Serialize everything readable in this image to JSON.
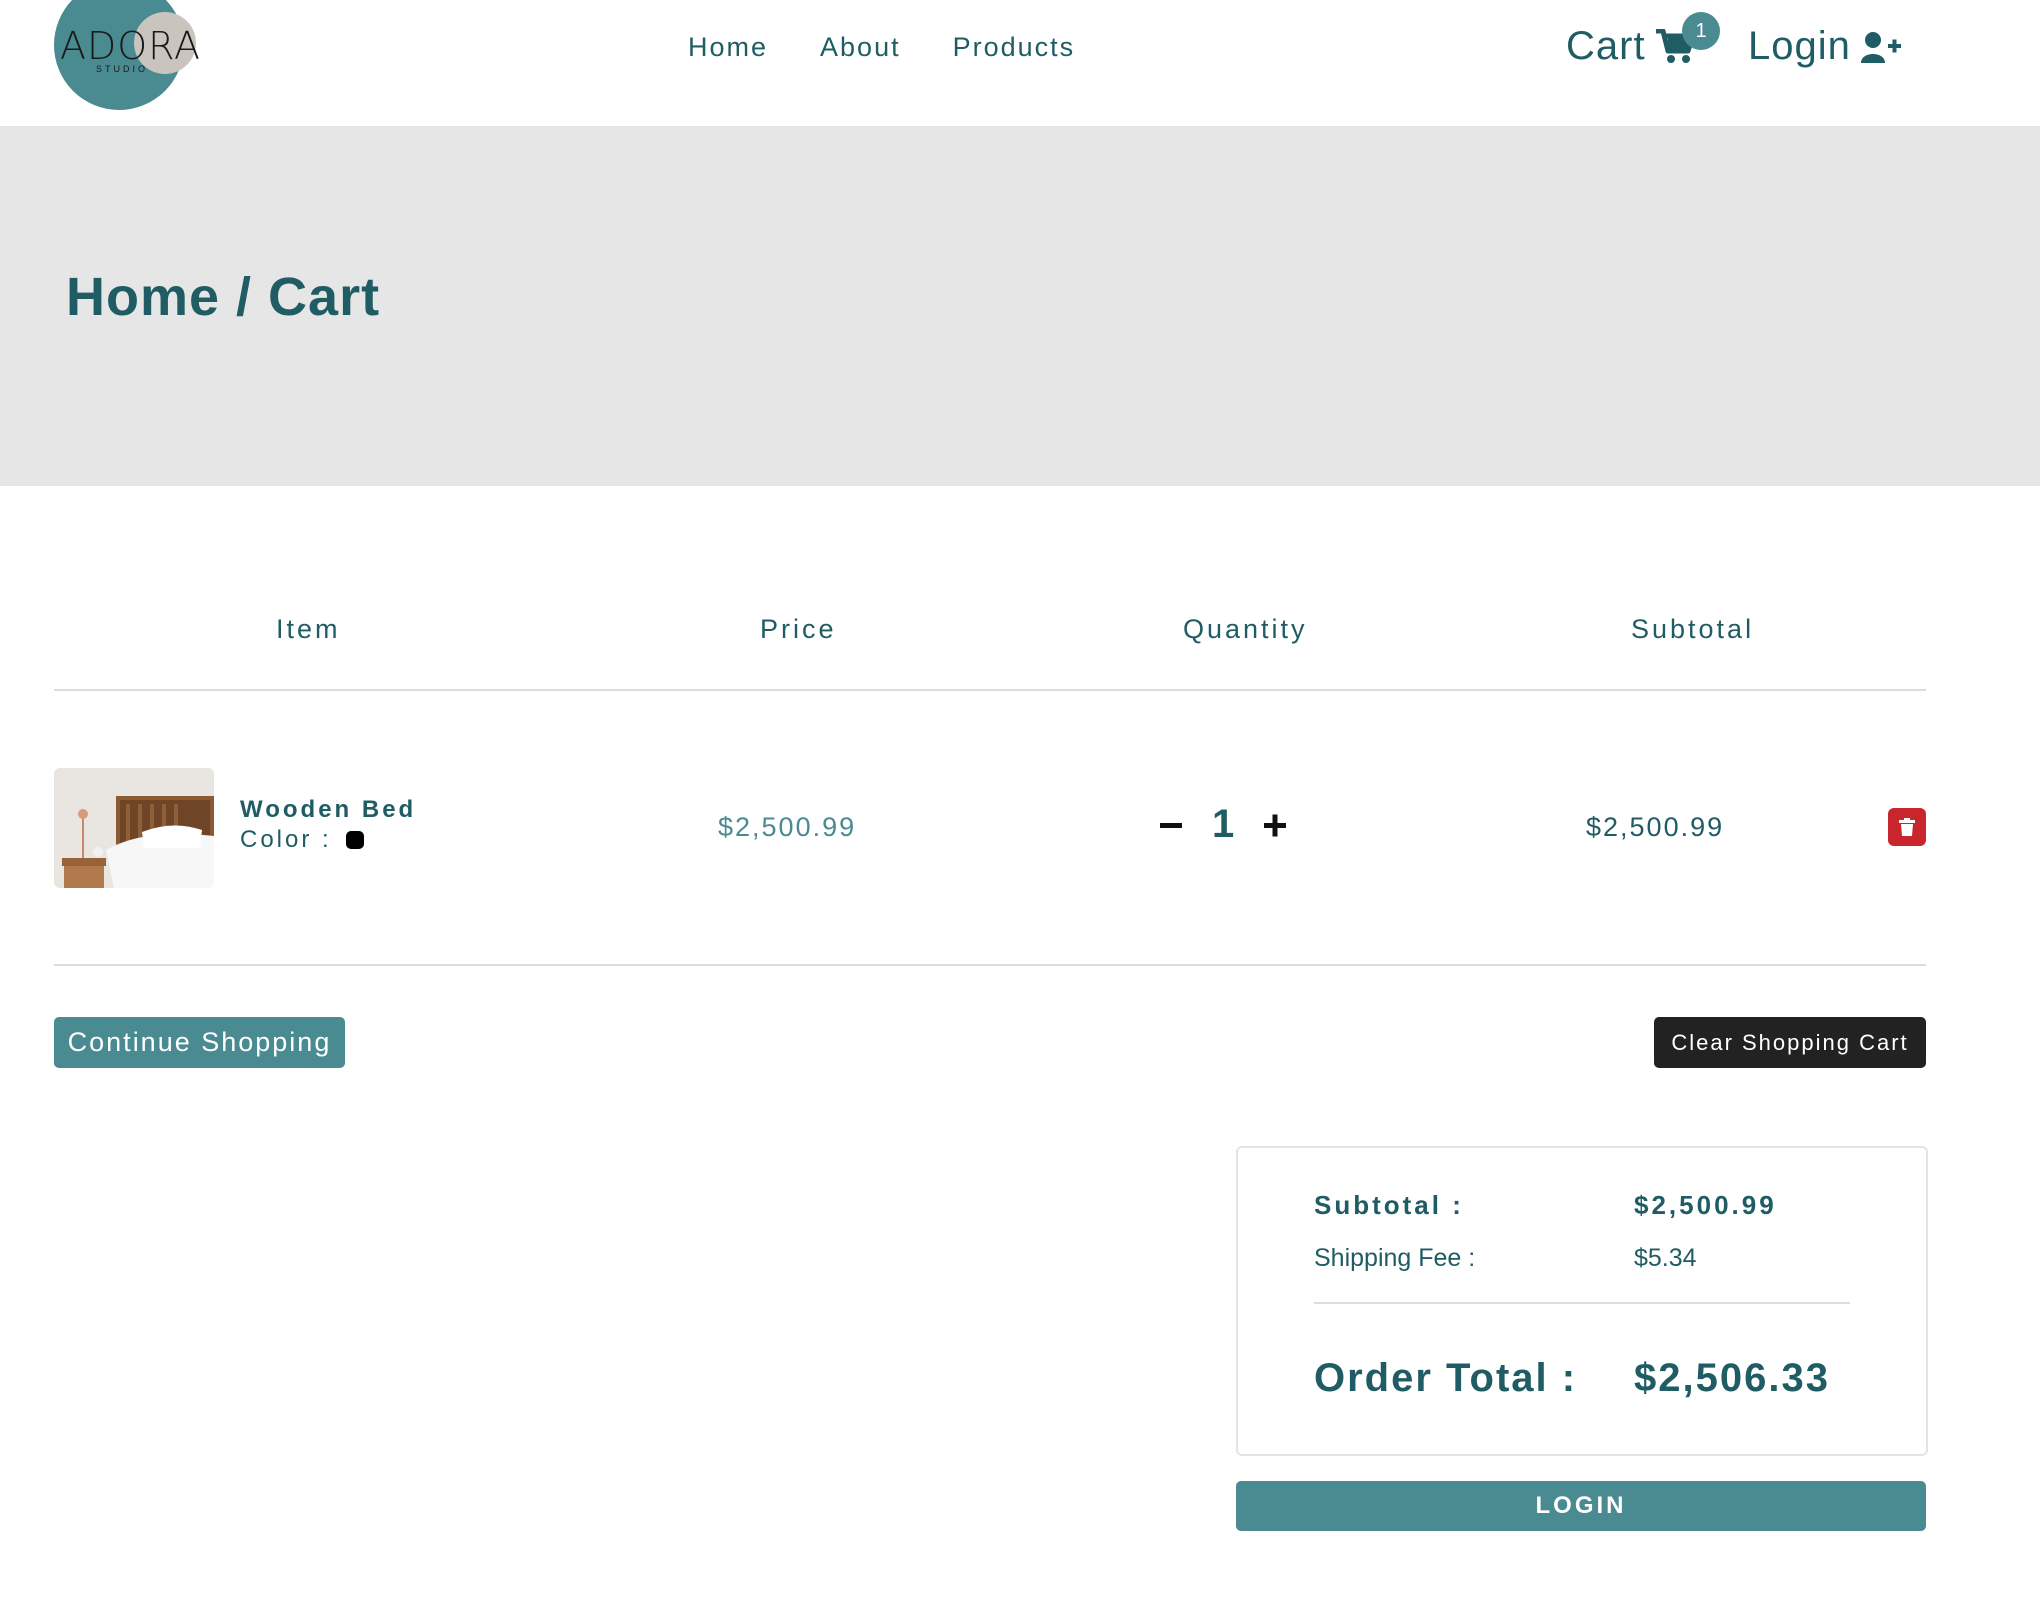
{
  "header": {
    "logo": {
      "word": "ADORA",
      "sub": "STUDIO"
    },
    "nav": [
      "Home",
      "About",
      "Products"
    ],
    "cart_label": "Cart",
    "cart_count": "1",
    "login_label": "Login"
  },
  "hero": {
    "breadcrumb": "Home / Cart"
  },
  "table": {
    "columns": [
      "Item",
      "Price",
      "Quantity",
      "Subtotal"
    ],
    "rows": [
      {
        "name": "Wooden Bed",
        "color_label": "Color :",
        "color": "#000000",
        "price": "$2,500.99",
        "quantity": "1",
        "subtotal": "$2,500.99"
      }
    ]
  },
  "actions": {
    "continue": "Continue Shopping",
    "clear": "Clear Shopping Cart"
  },
  "totals": {
    "subtotal_label": "Subtotal :",
    "subtotal_value": "$2,500.99",
    "shipping_label": "Shipping Fee :",
    "shipping_value": "$5.34",
    "order_label": "Order Total :",
    "order_value": "$2,506.33"
  },
  "login_button": "LOGIN",
  "colors": {
    "accent": "#4a8a91",
    "text": "#1f5c64",
    "danger": "#c9252c",
    "dark": "#222222",
    "hero_bg": "#e6e6e6"
  }
}
